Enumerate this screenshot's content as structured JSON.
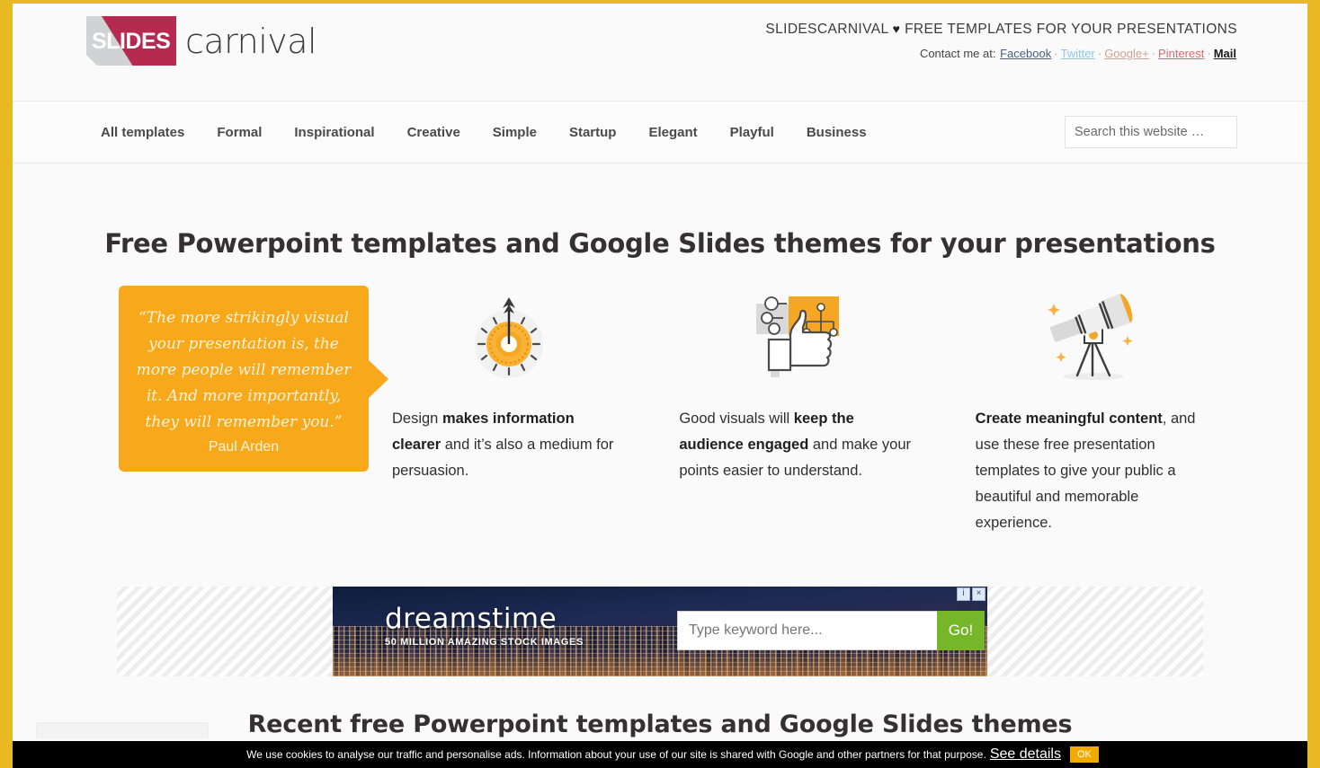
{
  "brand": {
    "logo_badge_text": "SLIDES",
    "logo_word": "carnival",
    "accent_orange": "#f7a81b",
    "accent_crimson": "#b52a4e",
    "frame_yellow": "#e8b923"
  },
  "header": {
    "tagline_prefix": "SLIDESCARNIVAL",
    "tagline_heart": "♥",
    "tagline_suffix": "FREE TEMPLATES FOR YOUR PRESENTATIONS",
    "contact_label": "Contact me at:",
    "contact_links": [
      {
        "label": "Facebook",
        "color": "#46617f"
      },
      {
        "label": "Twitter",
        "color": "#8ec9e8"
      },
      {
        "label": "Google+",
        "color": "#d0a08d"
      },
      {
        "label": "Pinterest",
        "color": "#d66a72"
      },
      {
        "label": "Mail",
        "color": "#1a1a1a"
      }
    ],
    "separator": "·"
  },
  "nav": {
    "items": [
      {
        "label": "All templates"
      },
      {
        "label": "Formal"
      },
      {
        "label": "Inspirational"
      },
      {
        "label": "Creative"
      },
      {
        "label": "Simple"
      },
      {
        "label": "Startup"
      },
      {
        "label": "Elegant"
      },
      {
        "label": "Playful"
      },
      {
        "label": "Business"
      }
    ]
  },
  "search": {
    "placeholder": "Search this website …",
    "value": ""
  },
  "hero": {
    "title": "Free Powerpoint templates and Google Slides themes for your presentations"
  },
  "quote": {
    "text": "“The more strikingly visual your presentation is, the more people will remember it. And more importantly, they will remember you.”",
    "author": "Paul Arden"
  },
  "features": [
    {
      "icon": "target-arrow-icon",
      "lead": "Design ",
      "bold": "makes information clearer",
      "rest": " and it’s also a medium for persuasion."
    },
    {
      "icon": "thumbs-up-icon",
      "lead": "Good visuals will ",
      "bold": "keep the audience engaged",
      "rest": " and make your points easier to understand."
    },
    {
      "icon": "telescope-icon",
      "lead": "",
      "bold": "Create meaningful content",
      "rest": ", and use these free presentation templates to give your public a beautiful and memorable experience."
    }
  ],
  "ad": {
    "brand_name": "dreamstime",
    "brand_sub": "50 MILLION AMAZING STOCK IMAGES",
    "search_placeholder": "Type keyword here...",
    "search_value": "",
    "go_label": "Go!",
    "info_badge": "i",
    "close_badge": "×"
  },
  "recent": {
    "title": "Recent free Powerpoint templates and Google Slides themes"
  },
  "cookie": {
    "message": "We use cookies to analyse our traffic and personalise ads. Information about your use of our site is shared with Google and other partners for that purpose.",
    "details_label": "See details",
    "ok_label": "OK"
  }
}
